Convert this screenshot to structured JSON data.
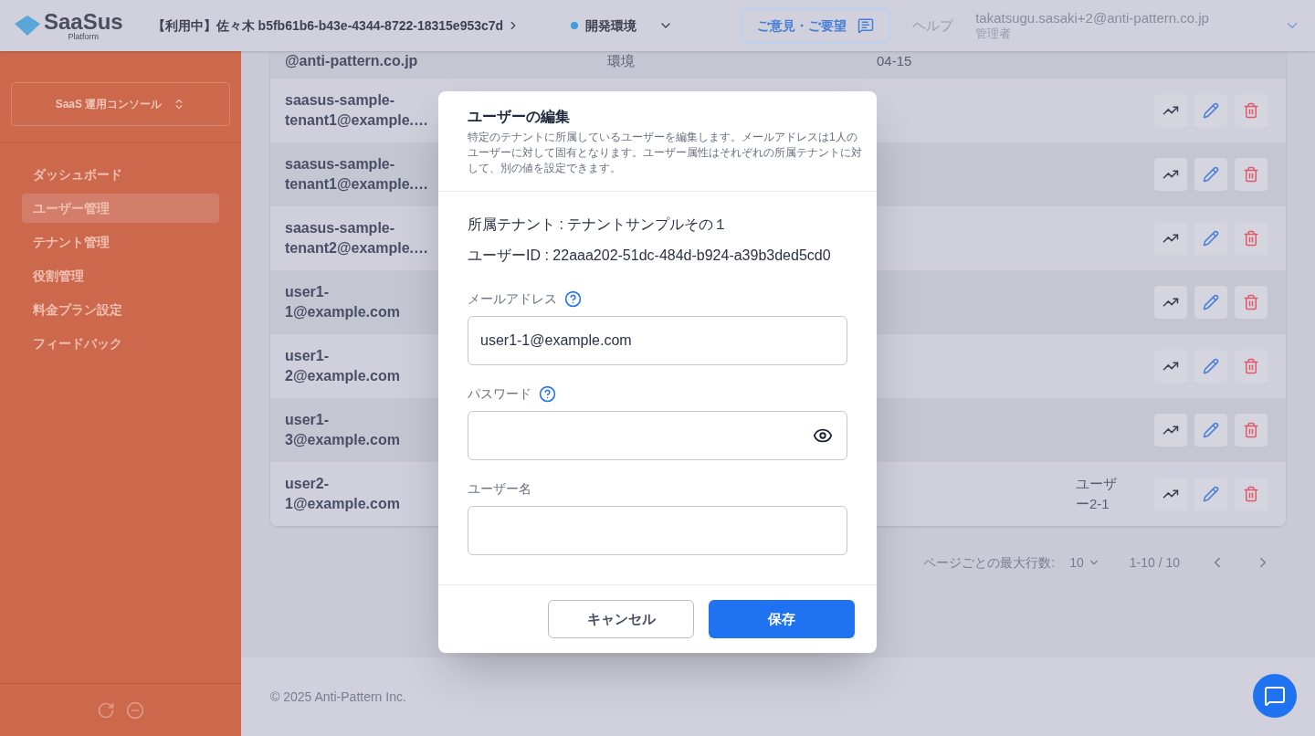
{
  "header": {
    "logo_text": "SaaSus",
    "logo_sub": "Platform",
    "tenant_breadcrumb": "【利用中】佐々木 b5fb61b6-b43e-4344-8722-18315e953c7d",
    "environment": {
      "label": "開発環境",
      "color": "#3b9ee0"
    },
    "feedback_button": "ご意見・ご要望",
    "help_link": "ヘルプ",
    "user_email": "takatsugu.sasaki+2@anti-pattern.co.jp",
    "user_role": "管理者"
  },
  "sidebar": {
    "console_switch": "SaaS 運用コンソール",
    "console_switch_expanded": false,
    "items": [
      {
        "label": "ダッシュボード",
        "selected": false
      },
      {
        "label": "ユーザー管理",
        "selected": true
      },
      {
        "label": "テナント管理",
        "selected": false
      },
      {
        "label": "役割管理",
        "selected": false
      },
      {
        "label": "料金プラン設定",
        "selected": false
      },
      {
        "label": "フィードバック",
        "selected": false
      }
    ]
  },
  "table": {
    "rows": [
      {
        "email": "@anti-pattern.co.jp",
        "column_2": "環境",
        "column_3": "04-15",
        "kind": "partial"
      },
      {
        "email": "saasus-sample-tenant1@example.…",
        "kind": "full"
      },
      {
        "email": "saasus-sample-tenant1@example.…",
        "kind": "full"
      },
      {
        "email": "saasus-sample-tenant2@example.…",
        "kind": "full"
      },
      {
        "email": "user1-1@example.com",
        "kind": "full"
      },
      {
        "email": "user1-2@example.com",
        "kind": "full"
      },
      {
        "email": "user1-3@example.com",
        "kind": "full"
      },
      {
        "email": "user2-1@example.com",
        "column_4": "ユーザー2-1",
        "kind": "full"
      }
    ]
  },
  "pagination": {
    "rows_per_page_label": "ページごとの最大行数:",
    "rows_per_page": "10",
    "range": "1-10 / 10"
  },
  "footer": "© 2025 Anti-Pattern Inc.",
  "dialog": {
    "title": "ユーザーの編集",
    "description": "特定のテナントに所属しているユーザーを編集します。メールアドレスは1人のユーザーに対して固有となります。ユーザー属性はそれぞれの所属テナントに対して、別の値を設定できます。",
    "tenant_line": "所属テナント : テナントサンプルその１",
    "user_id_line": "ユーザーID : 22aaa202-51dc-484d-b924-a39b3ded5cd0",
    "fields": [
      {
        "label": "メールアドレス",
        "kind": "text",
        "help": true,
        "value": "user1-1@example.com"
      },
      {
        "label": "パスワード",
        "kind": "password",
        "help": true
      },
      {
        "label": "ユーザー名",
        "kind": "text",
        "help": false
      }
    ],
    "buttons": [
      {
        "label": "キャンセル",
        "kind": "secondary"
      },
      {
        "label": "保存",
        "kind": "primary"
      }
    ]
  }
}
